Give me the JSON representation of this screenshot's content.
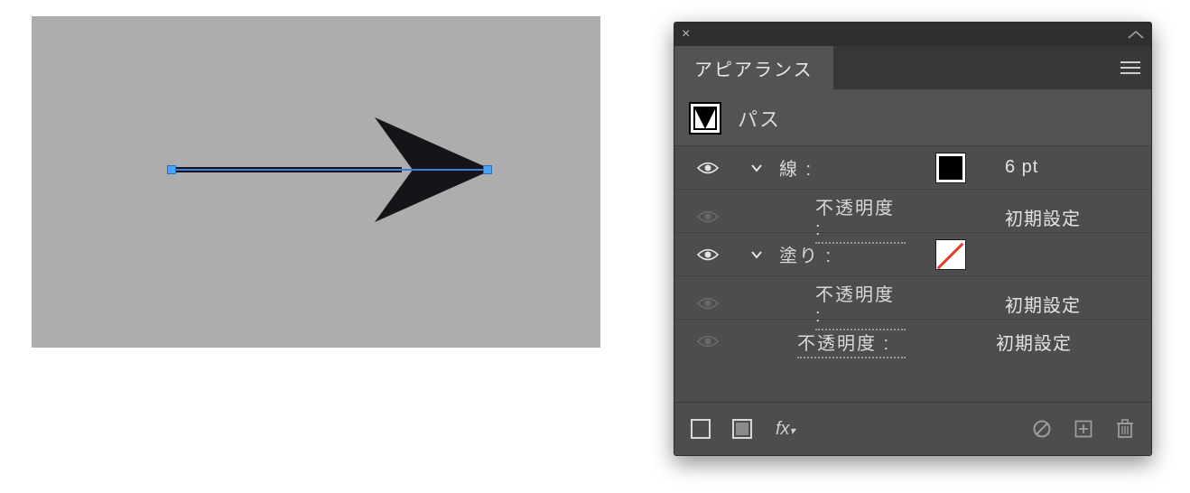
{
  "panel": {
    "title": "アピアランス",
    "object_label": "パス",
    "stroke": {
      "label": "線 :",
      "weight": "6 pt",
      "opacity_label": "不透明度 :",
      "opacity_value": "初期設定"
    },
    "fill": {
      "label": "塗り :",
      "opacity_label": "不透明度 :",
      "opacity_value": "初期設定"
    },
    "overall": {
      "opacity_label": "不透明度 :",
      "opacity_value": "初期設定"
    },
    "footer": {
      "fx": "fx"
    }
  }
}
